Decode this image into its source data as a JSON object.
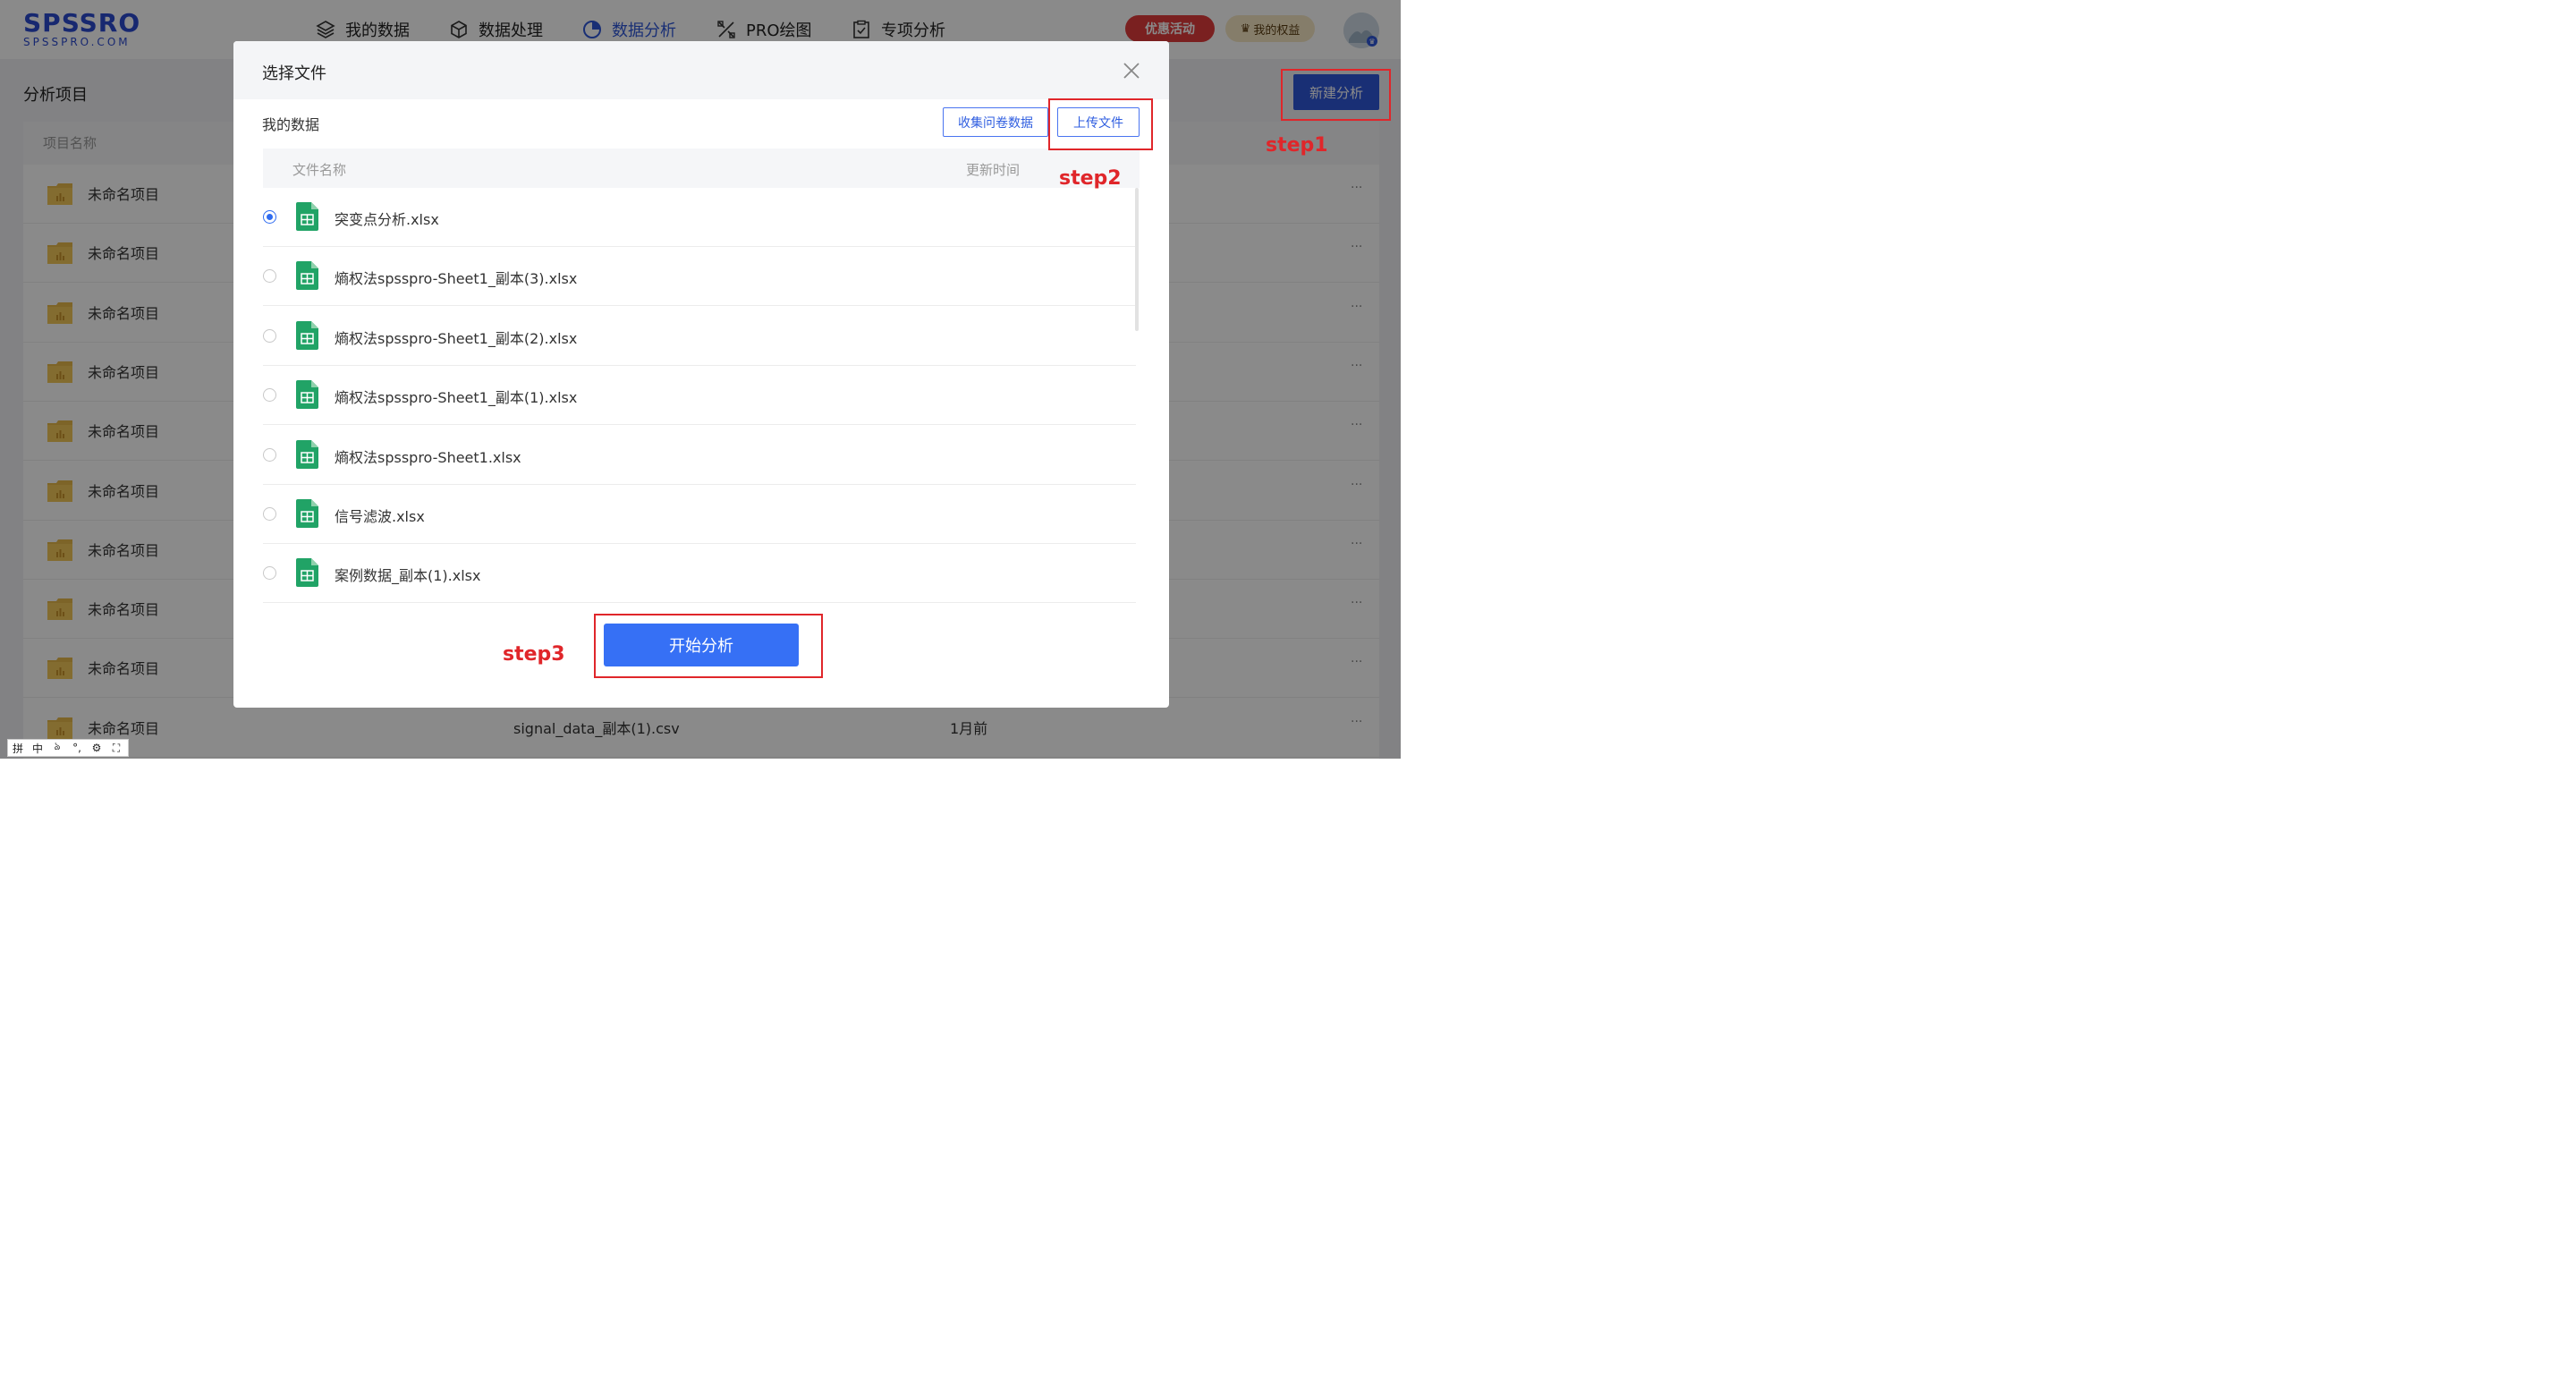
{
  "logo": {
    "main": "SPSSRO",
    "sub": "SPSSPRO.COM"
  },
  "nav": [
    {
      "label": "我的数据",
      "icon": "layers-icon"
    },
    {
      "label": "数据处理",
      "icon": "cube-icon"
    },
    {
      "label": "数据分析",
      "icon": "pie-chart-icon",
      "active": true
    },
    {
      "label": "PRO绘图",
      "icon": "draw-tools-icon"
    },
    {
      "label": "专项分析",
      "icon": "clipboard-check-icon"
    }
  ],
  "header": {
    "promo_label": "优惠活动",
    "rights_label": "我的权益"
  },
  "page": {
    "title": "分析项目",
    "new_button": "新建分析"
  },
  "table": {
    "col_name": "项目名称",
    "rows": [
      {
        "name": "未命名项目"
      },
      {
        "name": "未命名项目"
      },
      {
        "name": "未命名项目"
      },
      {
        "name": "未命名项目"
      },
      {
        "name": "未命名项目"
      },
      {
        "name": "未命名项目"
      },
      {
        "name": "未命名项目"
      },
      {
        "name": "未命名项目"
      },
      {
        "name": "未命名项目"
      },
      {
        "name": "未命名项目",
        "file": "signal_data_副本(1).csv",
        "time": "1月前"
      }
    ],
    "more": "···"
  },
  "ime": [
    "拼",
    "中",
    "ঌ",
    "°,",
    "⚙",
    "⛶"
  ],
  "modal": {
    "title": "选择文件",
    "section": "我的数据",
    "survey_button": "收集问卷数据",
    "upload_button": "上传文件",
    "col_file": "文件名称",
    "col_time": "更新时间",
    "files": [
      {
        "name": "突变点分析.xlsx",
        "selected": true
      },
      {
        "name": "熵权法spsspro-Sheet1_副本(3).xlsx",
        "selected": false
      },
      {
        "name": "熵权法spsspro-Sheet1_副本(2).xlsx",
        "selected": false
      },
      {
        "name": "熵权法spsspro-Sheet1_副本(1).xlsx",
        "selected": false
      },
      {
        "name": "熵权法spsspro-Sheet1.xlsx",
        "selected": false
      },
      {
        "name": "信号滤波.xlsx",
        "selected": false
      },
      {
        "name": "案例数据_副本(1).xlsx",
        "selected": false
      }
    ],
    "start_button": "开始分析"
  },
  "annotations": {
    "step1": "step1",
    "step2": "step2",
    "step3": "step3"
  },
  "colors": {
    "accent": "#2f57d8",
    "annotation": "#e0262a",
    "excel_green": "#21a366"
  }
}
